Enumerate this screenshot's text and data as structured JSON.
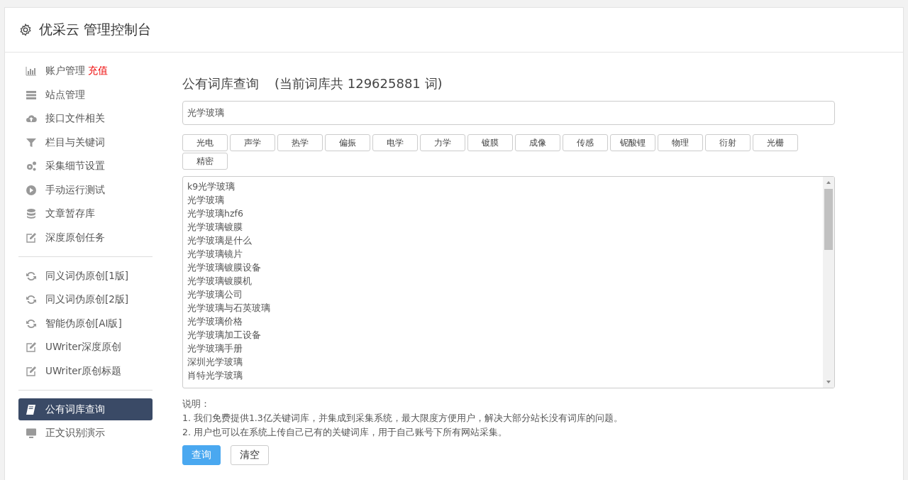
{
  "header": {
    "title": "优采云 管理控制台"
  },
  "sidebar": {
    "groups": [
      {
        "items": [
          {
            "label": "账户管理",
            "badge": "充值",
            "kind": "chart",
            "selected": false
          },
          {
            "label": "站点管理",
            "kind": "server",
            "selected": false
          },
          {
            "label": "接口文件相关",
            "kind": "cloud",
            "selected": false
          },
          {
            "label": "栏目与关键词",
            "kind": "filter",
            "selected": false
          },
          {
            "label": "采集细节设置",
            "kind": "gears",
            "selected": false
          },
          {
            "label": "手动运行测试",
            "kind": "play",
            "selected": false
          },
          {
            "label": "文章暂存库",
            "kind": "database",
            "selected": false
          },
          {
            "label": "深度原创任务",
            "kind": "edit",
            "selected": false
          }
        ]
      },
      {
        "items": [
          {
            "label": "同义词伪原创[1版]",
            "kind": "refresh",
            "selected": false
          },
          {
            "label": "同义词伪原创[2版]",
            "kind": "refresh",
            "selected": false
          },
          {
            "label": "智能伪原创[AI版]",
            "kind": "refresh",
            "selected": false
          },
          {
            "label": "UWriter深度原创",
            "kind": "edit",
            "selected": false
          },
          {
            "label": "UWriter原创标题",
            "kind": "edit",
            "selected": false
          }
        ]
      },
      {
        "items": [
          {
            "label": "公有词库查询",
            "kind": "book",
            "selected": true
          },
          {
            "label": "正文识别演示",
            "kind": "monitor",
            "selected": false
          }
        ]
      }
    ]
  },
  "main": {
    "title": "公有词库查询",
    "subtitle": "(当前词库共 129625881 词)",
    "search": {
      "value": "光学玻璃"
    },
    "tags": [
      "光电",
      "声学",
      "热学",
      "偏振",
      "电学",
      "力学",
      "镀膜",
      "成像",
      "传感",
      "铌酸锂",
      "物理",
      "衍射",
      "光栅",
      "精密"
    ],
    "results": [
      "k9光学玻璃",
      "光学玻璃",
      "光学玻璃hzf6",
      "光学玻璃镀膜",
      "光学玻璃是什么",
      "光学玻璃镜片",
      "光学玻璃镀膜设备",
      "光学玻璃镀膜机",
      "光学玻璃公司",
      "光学玻璃与石英玻璃",
      "光学玻璃价格",
      "光学玻璃加工设备",
      "光学玻璃手册",
      "深圳光学玻璃",
      "肖特光学玻璃"
    ],
    "notes": {
      "heading": "说明：",
      "lines": [
        "1. 我们免费提供1.3亿关键词库，并集成到采集系统，最大限度方便用户，解决大部分站长没有词库的问题。",
        "2. 用户也可以在系统上传自己已有的关键词库，用于自己账号下所有网站采集。"
      ]
    },
    "buttons": [
      {
        "label": "查询",
        "kind": "primary"
      },
      {
        "label": "清空",
        "kind": "default"
      }
    ]
  }
}
